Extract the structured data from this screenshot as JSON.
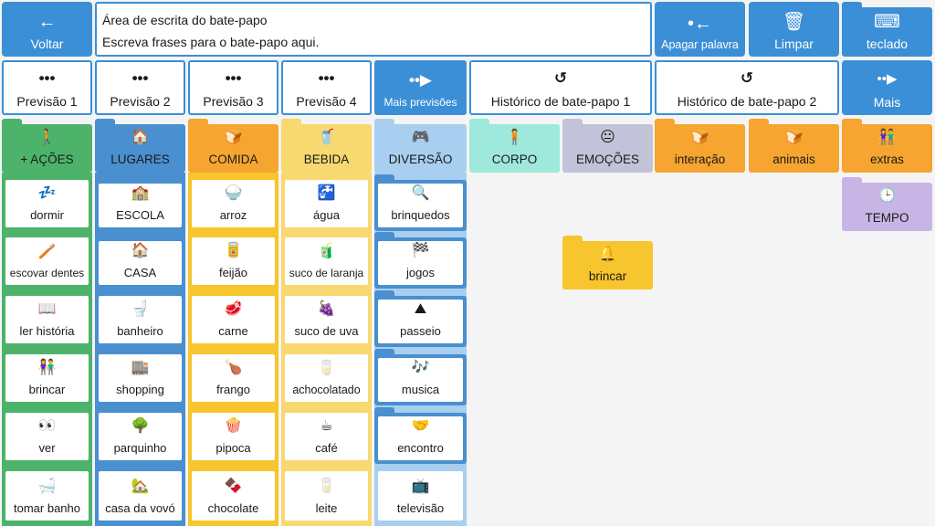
{
  "top": {
    "back": {
      "label": "Voltar",
      "icon": "arrow-left-icon"
    },
    "chat_title": "Área de escrita do bate-papo",
    "chat_placeholder": "Escreva frases para o bate-papo aqui.",
    "delete_word": {
      "label": "Apagar palavra",
      "icon": "backspace-icon"
    },
    "clear": {
      "label": "Limpar",
      "icon": "trash-icon"
    },
    "keyboard": {
      "label": "teclado",
      "icon": "keyboard-icon"
    }
  },
  "predictions": [
    {
      "label": "Previsão 1"
    },
    {
      "label": "Previsão 2"
    },
    {
      "label": "Previsão 3"
    },
    {
      "label": "Previsão 4"
    }
  ],
  "more_predictions": "Mais previsões",
  "history1": "Histórico de bate-papo 1",
  "history2": "Histórico de bate-papo 2",
  "more": "Mais",
  "categories": [
    {
      "label": "+ AÇÕES"
    },
    {
      "label": "LUGARES"
    },
    {
      "label": "COMIDA"
    },
    {
      "label": "BEBIDA"
    },
    {
      "label": "DIVERSÃO"
    },
    {
      "label": "CORPO"
    },
    {
      "label": "EMOÇÕES"
    },
    {
      "label": "interação"
    },
    {
      "label": "animais"
    },
    {
      "label": "extras"
    }
  ],
  "columns": {
    "acoes": [
      "dormir",
      "escovar dentes",
      "ler história",
      "brincar",
      "ver",
      "tomar banho"
    ],
    "lugares": [
      "ESCOLA",
      "CASA",
      "banheiro",
      "shopping",
      "parquinho",
      "casa da vovó"
    ],
    "comida": [
      "arroz",
      "feijão",
      "carne",
      "frango",
      "pipoca",
      "chocolate"
    ],
    "bebida": [
      "água",
      "suco de laranja",
      "suco de uva",
      "achocolatado",
      "café",
      "leite"
    ],
    "diversao": [
      "brinquedos",
      "jogos",
      "passeio",
      "musica",
      "encontro",
      "televisão"
    ]
  },
  "tempo": "TEMPO",
  "brincar_tile": "brincar"
}
